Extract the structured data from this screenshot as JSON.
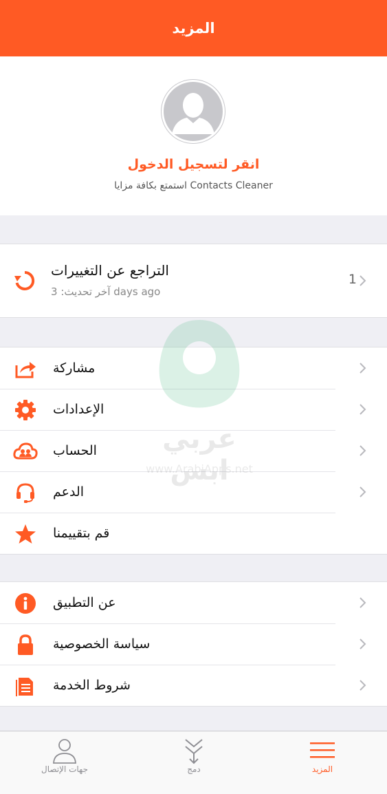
{
  "header": {
    "title": "المزيد"
  },
  "profile": {
    "login_label": "انقر لتسجيل الدخول",
    "subtitle": "استمتع بكافة مزايا Contacts Cleaner"
  },
  "undo": {
    "title": "التراجع عن التغييرات",
    "last_update": "آخر تحديث: 3 days ago",
    "count": "1"
  },
  "menu_group_1": [
    {
      "label": "مشاركة",
      "icon": "share-icon",
      "has_chevron": true
    },
    {
      "label": "الإعدادات",
      "icon": "gear-icon",
      "has_chevron": true
    },
    {
      "label": "الحساب",
      "icon": "cloud-account-icon",
      "has_chevron": true
    },
    {
      "label": "الدعم",
      "icon": "headset-icon",
      "has_chevron": true
    },
    {
      "label": "قم بتقييمنا",
      "icon": "star-icon",
      "has_chevron": false
    }
  ],
  "menu_group_2": [
    {
      "label": "عن التطبيق",
      "icon": "info-icon",
      "has_chevron": true
    },
    {
      "label": "سياسة الخصوصية",
      "icon": "lock-icon",
      "has_chevron": true
    },
    {
      "label": "شروط الخدمة",
      "icon": "document-icon",
      "has_chevron": true
    }
  ],
  "watermark": {
    "brand": "عربي ابس",
    "url": "www.ArabiApps.net"
  },
  "tabbar": {
    "contacts": "جهات الإتصال",
    "merge": "دمج",
    "more": "المزيد"
  },
  "colors": {
    "accent": "#ff5a24",
    "background": "#efeff4"
  }
}
